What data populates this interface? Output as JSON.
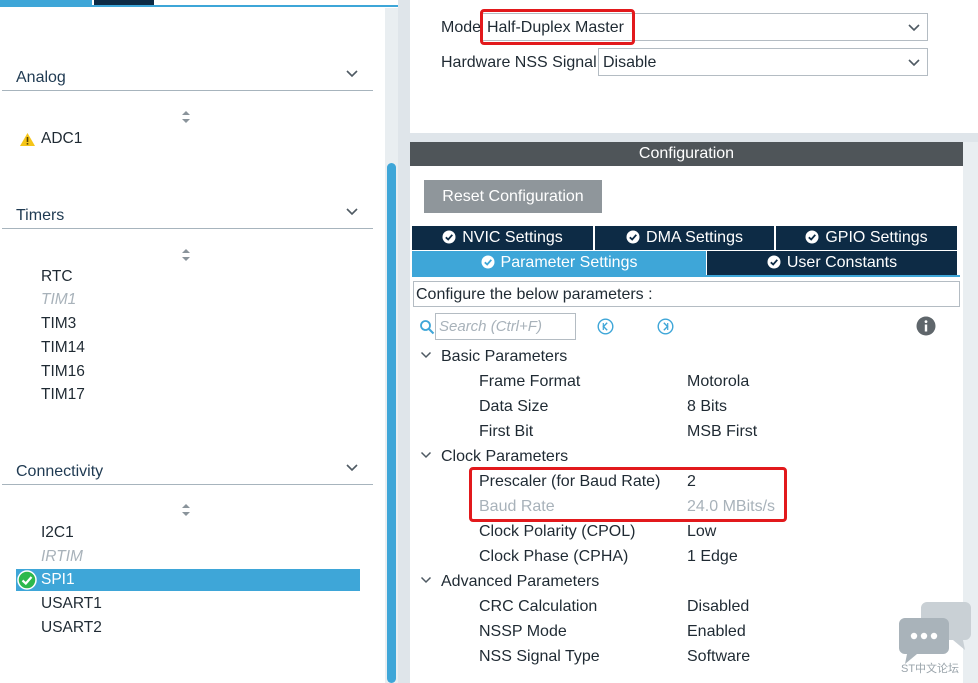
{
  "left": {
    "categories": [
      {
        "label": "Analog",
        "items": [
          {
            "label": "ADC1",
            "state": "warning"
          }
        ]
      },
      {
        "label": "Timers",
        "items": [
          {
            "label": "RTC",
            "state": "normal"
          },
          {
            "label": "TIM1",
            "state": "disabled"
          },
          {
            "label": "TIM3",
            "state": "normal"
          },
          {
            "label": "TIM14",
            "state": "normal"
          },
          {
            "label": "TIM16",
            "state": "normal"
          },
          {
            "label": "TIM17",
            "state": "normal"
          }
        ]
      },
      {
        "label": "Connectivity",
        "items": [
          {
            "label": "I2C1",
            "state": "normal"
          },
          {
            "label": "IRTIM",
            "state": "disabled"
          },
          {
            "label": "SPI1",
            "state": "selected"
          },
          {
            "label": "USART1",
            "state": "normal"
          },
          {
            "label": "USART2",
            "state": "normal"
          }
        ]
      }
    ]
  },
  "mode": {
    "mode_label": "Mode",
    "mode_value": "Half-Duplex Master",
    "nss_label": "Hardware NSS Signal",
    "nss_value": "Disable"
  },
  "config": {
    "header": "Configuration",
    "reset_label": "Reset Configuration",
    "tabs": [
      {
        "label": "NVIC Settings"
      },
      {
        "label": "DMA Settings"
      },
      {
        "label": "GPIO Settings"
      },
      {
        "label": "Parameter Settings",
        "active": true
      },
      {
        "label": "User Constants"
      }
    ],
    "description": "Configure the below parameters :",
    "search_placeholder": "Search (Ctrl+F)",
    "groups": [
      {
        "label": "Basic Parameters",
        "params": [
          {
            "name": "Frame Format",
            "value": "Motorola"
          },
          {
            "name": "Data Size",
            "value": "8 Bits"
          },
          {
            "name": "First Bit",
            "value": "MSB First"
          }
        ]
      },
      {
        "label": "Clock Parameters",
        "params": [
          {
            "name": "Prescaler (for Baud Rate)",
            "value": "2"
          },
          {
            "name": "Baud Rate",
            "value": "24.0 MBits/s",
            "readonly": true
          },
          {
            "name": "Clock Polarity (CPOL)",
            "value": "Low"
          },
          {
            "name": "Clock Phase (CPHA)",
            "value": "1 Edge"
          }
        ]
      },
      {
        "label": "Advanced Parameters",
        "params": [
          {
            "name": "CRC Calculation",
            "value": "Disabled"
          },
          {
            "name": "NSSP Mode",
            "value": "Enabled"
          },
          {
            "name": "NSS Signal Type",
            "value": "Software"
          }
        ]
      }
    ]
  },
  "watermark": {
    "label": "ST中文论坛"
  },
  "colors": {
    "accent": "#3ea6d8",
    "navy": "#0d2b45",
    "highlight": "#e2191c",
    "disabled_text": "#a8b2ba",
    "warning": "#f5c518",
    "ok": "#2db84d"
  }
}
